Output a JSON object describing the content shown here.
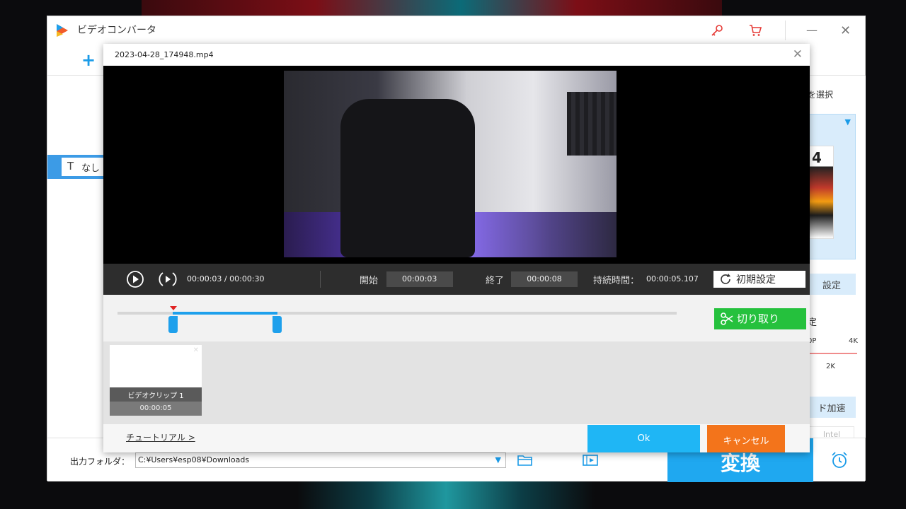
{
  "app": {
    "title": "ビデオコンバータ",
    "icons": [
      "key-icon",
      "cart-icon",
      "minimize-icon",
      "close-icon"
    ]
  },
  "main": {
    "add_label": "+",
    "subtitle_value": "なし",
    "right_panel": {
      "select_label": "を選択",
      "format_thumb_text": "4",
      "settings_label": "設定",
      "quality_label": "定",
      "quality_low": "0P",
      "quality_high": "4K",
      "quality_mid": "2K",
      "hw_accel_label": "ド加速",
      "intel_label": "Intel"
    },
    "output": {
      "label": "出力フォルダ：",
      "path": "C:¥Users¥esp08¥Downloads"
    },
    "convert_label": "変換"
  },
  "trim_dialog": {
    "title": "2023-04-28_174948.mp4",
    "controls": {
      "time_current": "00:00:03",
      "time_total": "00:00:30",
      "time_sep": "/",
      "start_label": "開始",
      "start_value": "00:00:03",
      "end_label": "終了",
      "end_value": "00:00:08",
      "duration_label": "持続時間：",
      "duration_value": "00:00:05.107",
      "reset_label": "初期設定"
    },
    "timeline": {
      "playhead_position": 0.1,
      "selection_start": 0.1,
      "selection_end": 0.287,
      "cut_label": "切り取り"
    },
    "clips": [
      {
        "name": "ビデオクリップ 1",
        "duration": "00:00:05"
      }
    ],
    "footer": {
      "tutorial_label": "チュートリアル >",
      "ok_label": "Ok",
      "cancel_label": "キャンセル"
    }
  },
  "colors": {
    "accent_blue": "#1ea0ec",
    "cut_green": "#25c13d",
    "cancel_orange": "#f3741b",
    "ok_blue": "#1fb6f5",
    "convert_blue": "#1fa8f0"
  }
}
